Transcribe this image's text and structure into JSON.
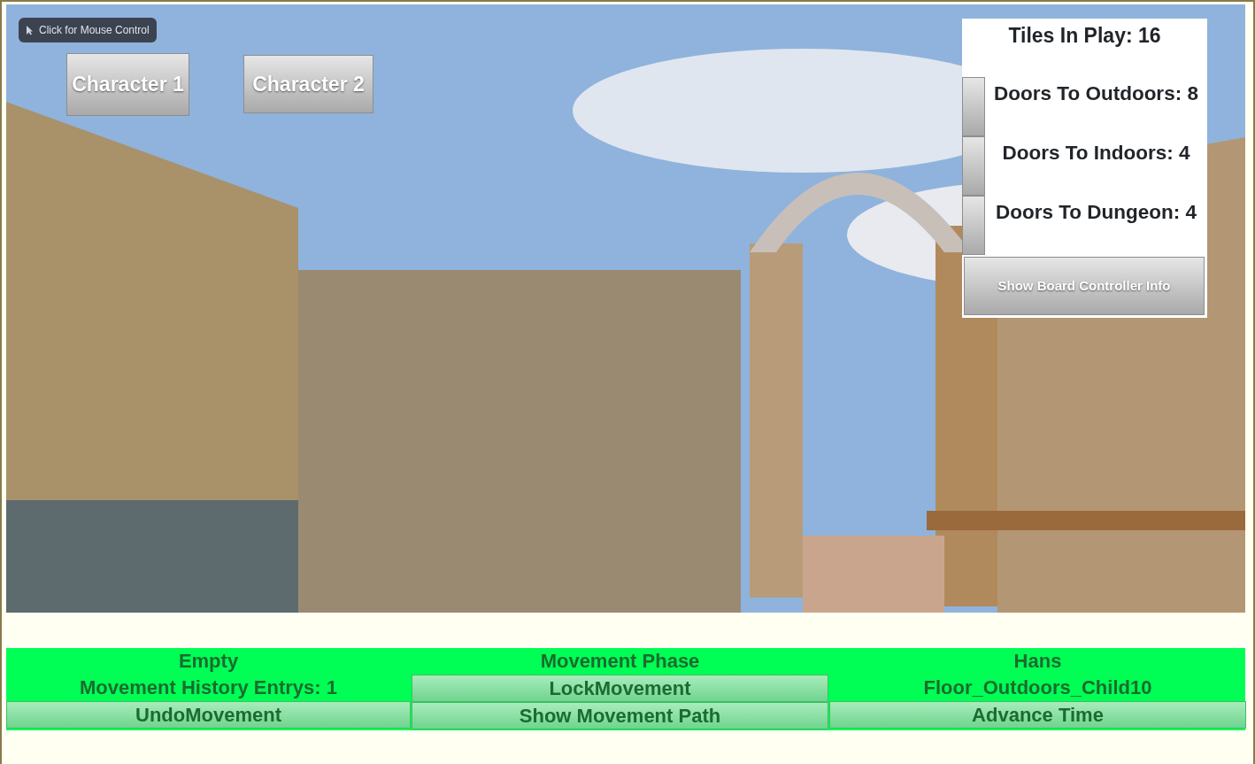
{
  "mouse_control_hint": "Click for Mouse Control",
  "character_buttons": [
    {
      "label": "Character 1"
    },
    {
      "label": "Character 2"
    }
  ],
  "board_panel": {
    "tiles": "Tiles In Play: 16",
    "doors": [
      {
        "label": "Doors To Outdoors: 8"
      },
      {
        "label": "Doors To Indoors: 4"
      },
      {
        "label": "Doors To Dungeon: 4"
      }
    ],
    "info_button": "Show Board Controller Info"
  },
  "columns": [
    {
      "items": [
        {
          "kind": "text",
          "text": "Empty"
        },
        {
          "kind": "text",
          "text": "Movement History Entrys: 1"
        },
        {
          "kind": "button",
          "text": "UndoMovement"
        }
      ]
    },
    {
      "items": [
        {
          "kind": "text",
          "text": "Movement Phase"
        },
        {
          "kind": "button",
          "text": "LockMovement"
        },
        {
          "kind": "button",
          "text": "Show Movement Path"
        }
      ]
    },
    {
      "items": [
        {
          "kind": "text",
          "text": "Hans"
        },
        {
          "kind": "text",
          "text": "Floor_Outdoors_Child10"
        },
        {
          "kind": "button",
          "text": "Advance Time"
        }
      ]
    }
  ]
}
